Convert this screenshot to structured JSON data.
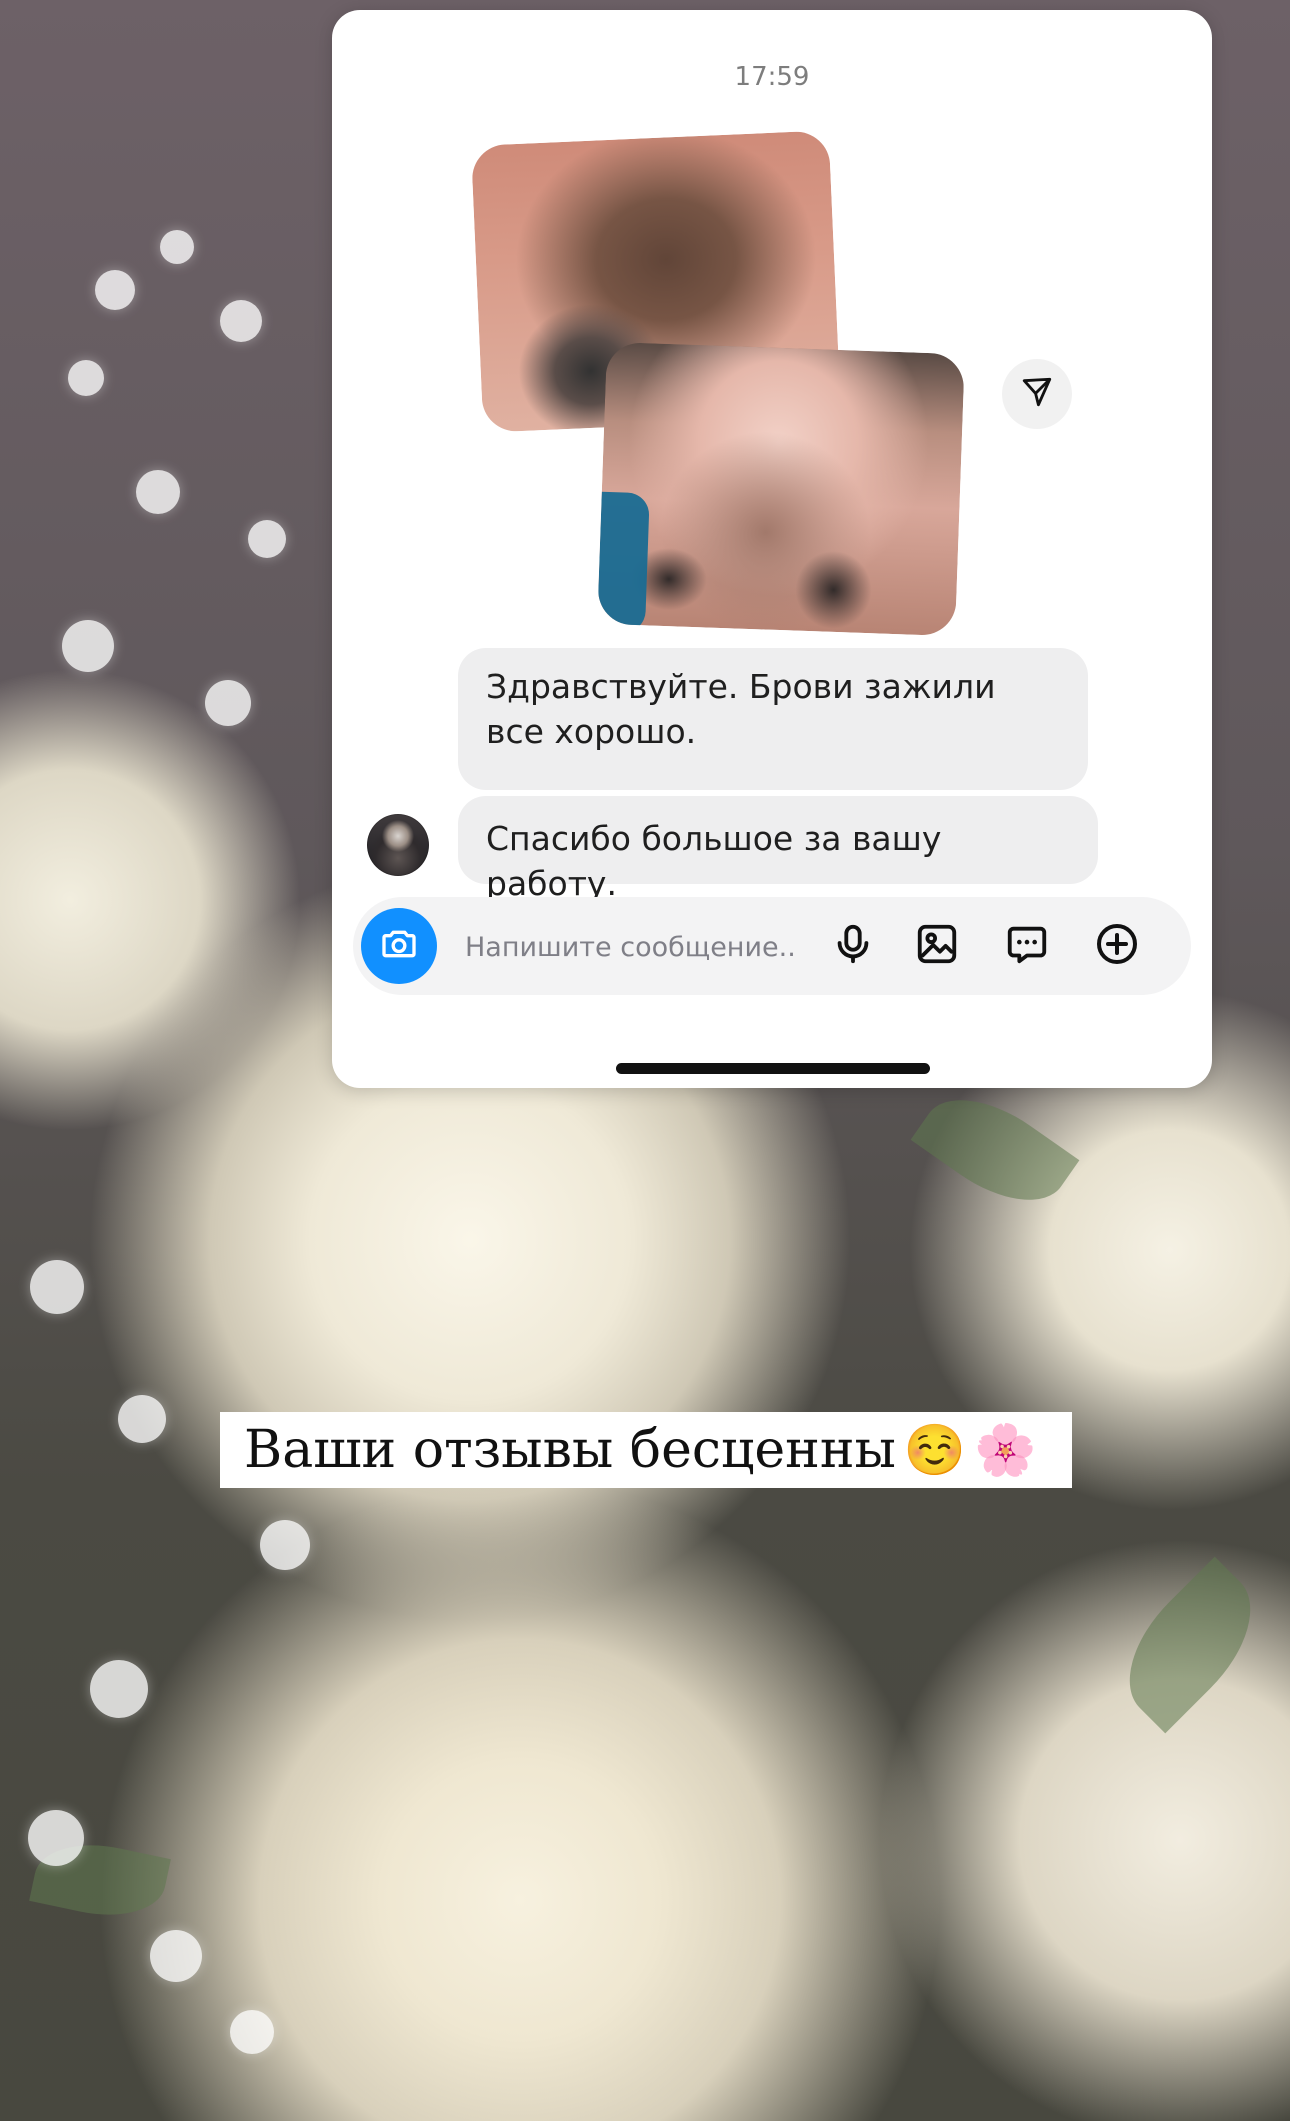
{
  "chat": {
    "time": "17:59",
    "messages": [
      "Здравствуйте. Брови зажили все хорошо.",
      "Спасибо большое за вашу работу."
    ]
  },
  "composer": {
    "placeholder": "Напишите сообщение..."
  },
  "caption": {
    "text": "Ваши отзывы бесценны",
    "emoji_1": "☺️",
    "emoji_2": "🌸"
  },
  "colors": {
    "accent": "#1190ff",
    "bubble": "#eeeeef",
    "background_dark": "#5f585b"
  },
  "icons": {
    "share": "paper-plane-icon",
    "camera": "camera-icon",
    "microphone": "microphone-icon",
    "gallery": "gallery-icon",
    "sticker": "sticker-icon",
    "plus": "plus-circle-icon"
  }
}
